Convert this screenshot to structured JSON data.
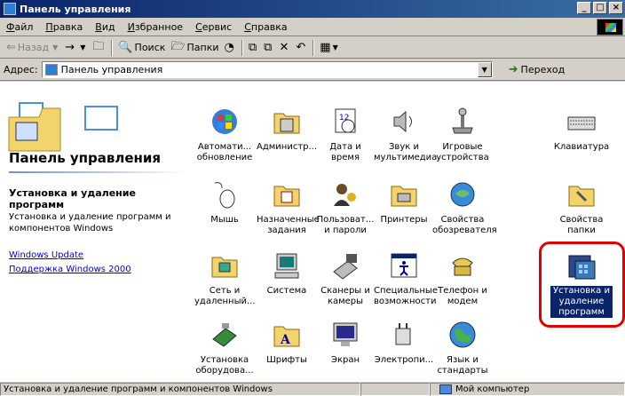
{
  "window": {
    "title": "Панель управления",
    "buttons": [
      "_",
      "□",
      "×"
    ]
  },
  "menu": {
    "items": [
      "Файл",
      "Правка",
      "Вид",
      "Избранное",
      "Сервис",
      "Справка"
    ]
  },
  "toolbar": {
    "back": "Назад",
    "forward": "→",
    "search": "Поиск",
    "folders": "Папки"
  },
  "address": {
    "label": "Адрес:",
    "value": "Панель управления",
    "go": "Переход"
  },
  "leftpane": {
    "title": "Панель управления",
    "selected_title": "Установка и удаление программ",
    "selected_desc": "Установка и удаление программ и компонентов Windows",
    "links": [
      "Windows Update",
      "Поддержка Windows 2000"
    ]
  },
  "items": [
    {
      "label": "Автомати... обновление",
      "icon": "windows-update-icon"
    },
    {
      "label": "Администр...",
      "icon": "administrative-tools-icon"
    },
    {
      "label": "Дата и время",
      "icon": "date-time-icon"
    },
    {
      "label": "Звук и мультимедиа",
      "icon": "sound-icon"
    },
    {
      "label": "Игровые устройства",
      "icon": "joystick-icon"
    },
    {
      "label": "Клавиатура",
      "icon": "keyboard-icon"
    },
    {
      "label": "Мышь",
      "icon": "mouse-icon"
    },
    {
      "label": "Назначенные задания",
      "icon": "scheduled-tasks-icon"
    },
    {
      "label": "Пользоват... и пароли",
      "icon": "users-icon"
    },
    {
      "label": "Принтеры",
      "icon": "printer-icon"
    },
    {
      "label": "Свойства обозревателя",
      "icon": "internet-options-icon"
    },
    {
      "label": "Свойства папки",
      "icon": "folder-options-icon"
    },
    {
      "label": "Сеть и удаленный...",
      "icon": "network-icon"
    },
    {
      "label": "Система",
      "icon": "system-icon"
    },
    {
      "label": "Сканеры и камеры",
      "icon": "scanner-icon"
    },
    {
      "label": "Специальные возможности",
      "icon": "accessibility-icon"
    },
    {
      "label": "Телефон и модем",
      "icon": "phone-modem-icon"
    },
    {
      "label": "Установка и удаление программ",
      "icon": "add-remove-programs-icon"
    },
    {
      "label": "Установка оборудова...",
      "icon": "add-hardware-icon"
    },
    {
      "label": "Шрифты",
      "icon": "fonts-icon"
    },
    {
      "label": "Экран",
      "icon": "display-icon"
    },
    {
      "label": "Электропи...",
      "icon": "power-icon"
    },
    {
      "label": "Язык и стандарты",
      "icon": "regional-settings-icon"
    }
  ],
  "status": {
    "text": "Установка и удаление программ и компонентов Windows",
    "zone": "Мой компьютер"
  },
  "colors": {
    "titlebar": "#0a246a",
    "selection": "#0a246a",
    "highlight_ring": "#e00000",
    "link": "#0000ee"
  }
}
